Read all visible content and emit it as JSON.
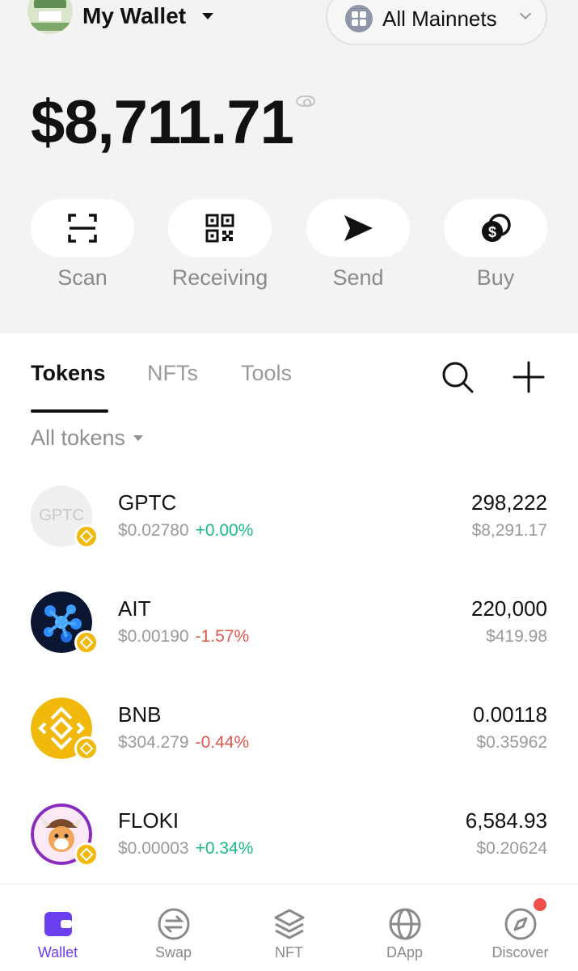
{
  "header": {
    "wallet_name": "My Wallet",
    "network_label": "All Mainnets"
  },
  "balance": {
    "total": "$8,711.71"
  },
  "actions": [
    {
      "label": "Scan",
      "icon": "scan-icon"
    },
    {
      "label": "Receiving",
      "icon": "qr-code-icon"
    },
    {
      "label": "Send",
      "icon": "send-icon"
    },
    {
      "label": "Buy",
      "icon": "coins-icon"
    }
  ],
  "tabs": [
    {
      "label": "Tokens",
      "active": true
    },
    {
      "label": "NFTs",
      "active": false
    },
    {
      "label": "Tools",
      "active": false
    }
  ],
  "filter": {
    "label": "All tokens"
  },
  "tokens": [
    {
      "symbol": "GPTC",
      "logo_text": "GPTC",
      "price": "$0.02780",
      "change": "+0.00%",
      "direction": "up",
      "amount": "298,222",
      "value": "$8,291.17"
    },
    {
      "symbol": "AIT",
      "logo_text": "",
      "price": "$0.00190",
      "change": "-1.57%",
      "direction": "down",
      "amount": "220,000",
      "value": "$419.98"
    },
    {
      "symbol": "BNB",
      "logo_text": "",
      "price": "$304.279",
      "change": "-0.44%",
      "direction": "down",
      "amount": "0.00118",
      "value": "$0.35962"
    },
    {
      "symbol": "FLOKI",
      "logo_text": "",
      "price": "$0.00003",
      "change": "+0.34%",
      "direction": "up",
      "amount": "6,584.93",
      "value": "$0.20624"
    }
  ],
  "bottom_nav": [
    {
      "label": "Wallet",
      "icon": "wallet-icon",
      "active": true
    },
    {
      "label": "Swap",
      "icon": "swap-icon",
      "active": false
    },
    {
      "label": "NFT",
      "icon": "layers-icon",
      "active": false
    },
    {
      "label": "DApp",
      "icon": "globe-icon",
      "active": false
    },
    {
      "label": "Discover",
      "icon": "compass-icon",
      "active": false
    }
  ],
  "colors": {
    "accent": "#6b3ef0",
    "up": "#1bb98a",
    "down": "#e2574c",
    "bnb": "#f0b90b"
  }
}
